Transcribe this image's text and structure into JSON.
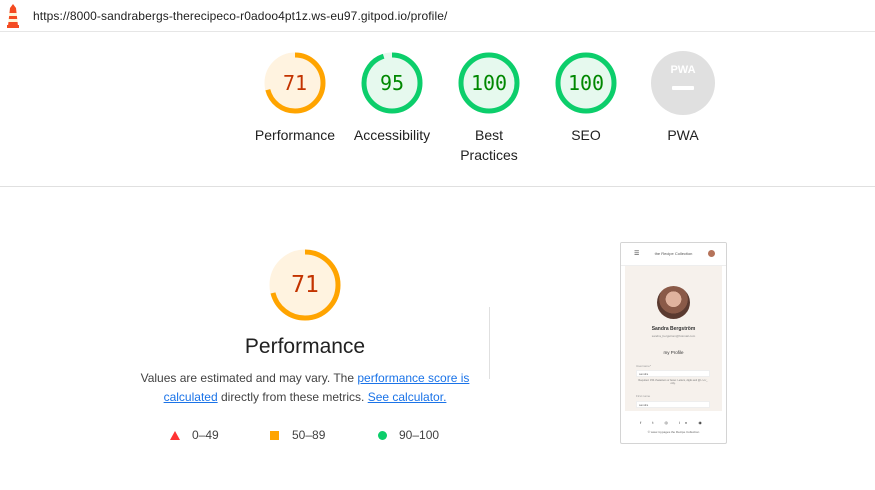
{
  "browser": {
    "url": "https://8000-sandrabergs-therecipeco-r0adoo4pt1z.ws-eu97.gitpod.io/profile/"
  },
  "gauges": [
    {
      "label": "Performance",
      "score": "71",
      "value": 0.71,
      "color": "#ffa400",
      "text_color": "#c33300",
      "fill": "#fff3e0"
    },
    {
      "label": "Accessibility",
      "score": "95",
      "value": 0.95,
      "color": "#0cce6b",
      "text_color": "#008800",
      "fill": "#e6f9ee"
    },
    {
      "label": "Best Practices",
      "score": "100",
      "value": 1.0,
      "color": "#0cce6b",
      "text_color": "#008800",
      "fill": "#e6f9ee"
    },
    {
      "label": "SEO",
      "score": "100",
      "value": 1.0,
      "color": "#0cce6b",
      "text_color": "#008800",
      "fill": "#e6f9ee"
    },
    {
      "label": "PWA",
      "score": "PWA",
      "value": 0,
      "color": "#d9d9d9",
      "text_color": "#ffffff",
      "fill": "#e0e0e0"
    }
  ],
  "performance": {
    "score": "71",
    "value": 0.71,
    "title": "Performance",
    "desc_text1": "Values are estimated and may vary. The ",
    "desc_link1": "performance score is calculated",
    "desc_text2": " directly from these metrics. ",
    "desc_link2": "See calculator."
  },
  "legend": {
    "fail": "0–49",
    "average": "50–89",
    "pass": "90–100",
    "colors": {
      "fail": "#ff3333",
      "average": "#ffa400",
      "pass": "#0cce6b"
    }
  },
  "screenshot": {
    "brand": "the Recipe Collection",
    "name": "Sandra Bergström",
    "email": "sandra_bergstrom@hotmail.com",
    "heading": "my Profile",
    "username_label": "Username*",
    "username_value": "sandra",
    "help_text": "Required. 150 characters or fewer. Letters, digits and @/./+/-/_ only.",
    "firstname_label": "First name",
    "firstname_value": "sandra",
    "social": "f t ◎ in ◉",
    "footer": "© www.mypages.the Recipe Collection"
  }
}
